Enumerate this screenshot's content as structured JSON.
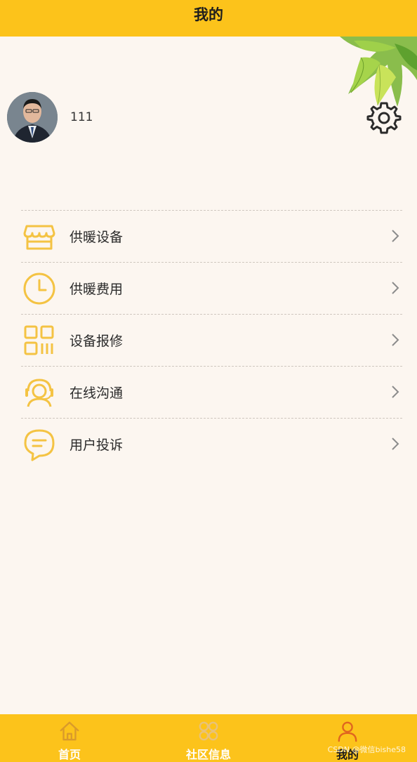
{
  "header": {
    "title": "我的"
  },
  "profile": {
    "username": "111"
  },
  "menu": {
    "items": [
      {
        "label": "供暖设备",
        "icon": "store-icon"
      },
      {
        "label": "供暖费用",
        "icon": "clock-icon"
      },
      {
        "label": "设备报修",
        "icon": "qr-code-icon"
      },
      {
        "label": "在线沟通",
        "icon": "headset-icon"
      },
      {
        "label": "用户投诉",
        "icon": "chat-bubble-icon"
      }
    ]
  },
  "tabbar": {
    "tabs": [
      {
        "label": "首页",
        "icon": "home-icon",
        "active": false
      },
      {
        "label": "社区信息",
        "icon": "grid-icon",
        "active": false
      },
      {
        "label": "我的",
        "icon": "user-icon",
        "active": true
      }
    ]
  },
  "watermark": "CSDN @微信bishe58",
  "colors": {
    "brand": "#fcc31b",
    "icon_accent": "#f4c343",
    "background": "#fcf6f0",
    "active_tab_icon": "#e0651f"
  }
}
